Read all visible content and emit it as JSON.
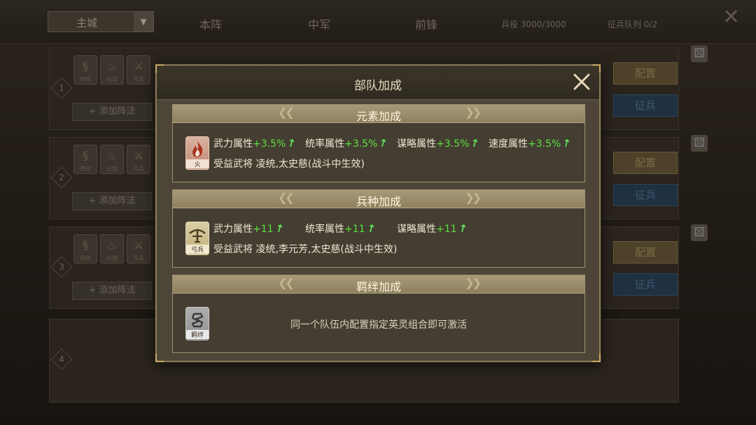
{
  "background": {
    "city_select": "主城",
    "tabs": [
      "本阵",
      "中军",
      "前锋"
    ],
    "troops": "兵役 3000/3000",
    "queue": "征兵队列 0/2",
    "rows": [
      {
        "num": "1",
        "slots": [
          "帅印",
          "火焰",
          "弓兵"
        ],
        "add_tactic": "+ 添加阵法",
        "config": "配置",
        "action": "征兵"
      },
      {
        "num": "2",
        "slots": [
          "帅印",
          "火焰",
          "弓兵"
        ],
        "add_tactic": "+ 添加阵法",
        "config": "配置",
        "action": "征兵"
      },
      {
        "num": "3",
        "slots": [
          "帅印",
          "火焰",
          "弓兵"
        ],
        "add_tactic": "+ 添加阵法",
        "config": "配置",
        "action": "征兵"
      },
      {
        "num": "4"
      }
    ]
  },
  "modal": {
    "title": "部队加成",
    "close_icon": "close-x-icon",
    "sections": [
      {
        "title": "元素加成",
        "badge": {
          "icon": "fire-icon",
          "label": "火"
        },
        "attributes": [
          {
            "name": "武力属性",
            "value": "+3.5%"
          },
          {
            "name": "统率属性",
            "value": "+3.5%"
          },
          {
            "name": "谋略属性",
            "value": "+3.5%"
          },
          {
            "name": "速度属性",
            "value": "+3.5%"
          }
        ],
        "benefit_label": "受益武将",
        "benefit_value": "凌统,太史慈(战斗中生效)"
      },
      {
        "title": "兵种加成",
        "badge": {
          "icon": "crossbow-icon",
          "label": "弓兵"
        },
        "attributes": [
          {
            "name": "武力属性",
            "value": "+11"
          },
          {
            "name": "统率属性",
            "value": "+11"
          },
          {
            "name": "谋略属性",
            "value": "+11"
          }
        ],
        "benefit_label": "受益武将",
        "benefit_value": "凌统,李元芳,太史慈(战斗中生效)"
      },
      {
        "title": "羁绊加成",
        "badge": {
          "icon": "bond-icon",
          "label": "羁绊"
        },
        "hint": "同一个队伍内配置指定英灵组合即可激活"
      }
    ]
  },
  "colors": {
    "accent_gold": "#c8a864",
    "positive_green": "#59e33e",
    "modal_bg": "#4d4638"
  }
}
